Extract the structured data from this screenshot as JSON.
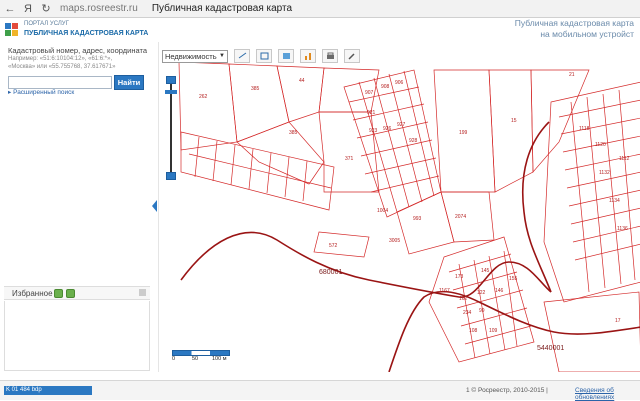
{
  "browser": {
    "back_icon": "back-arrow-icon",
    "yandex_label": "Я",
    "url": "maps.rosreestr.ru",
    "tab_title": "Публичная кадастровая карта"
  },
  "portal": {
    "logo_line1": "ПОРТАЛ УСЛУГ",
    "logo_line2": "ПУБЛИЧНАЯ КАДАСТРОВАЯ КАРТА",
    "mobile_line1": "Публичная кадастровая карта",
    "mobile_line2": "на мобильном устройст"
  },
  "search": {
    "label": "Кадастровый номер, адрес, координата",
    "example1": "Например: «51:6:10104:12», «61:6:*»,",
    "example2": "«Москва» или «55.755768, 37.617671»",
    "value": "",
    "find_button": "Найти",
    "advanced_link": "▸ Расширенный поиск"
  },
  "favorites": {
    "label": "Избранное"
  },
  "toolbar": {
    "layer_select": "Недвижимость"
  },
  "scale": {
    "ticks": [
      "0",
      "50",
      "100 м"
    ]
  },
  "status": {
    "coords": "K 01 484 bdp",
    "copyright": "1 © Росреестр, 2010-2015 |",
    "updates_link": "Сведения об обновлениях"
  },
  "map": {
    "block_labels": [
      "680001",
      "5440001",
      "3005",
      "1112"
    ],
    "parcel_labels": [
      "262",
      "385",
      "44",
      "385",
      "371",
      "199",
      "15",
      "21",
      "907",
      "908",
      "906",
      "921",
      "923",
      "926",
      "927",
      "928",
      "1004",
      "993",
      "2074",
      "572",
      "145",
      "146",
      "122",
      "99",
      "162",
      "1167",
      "108",
      "109",
      "155",
      "173",
      "234",
      "1118",
      "1120",
      "1132",
      "1134",
      "1136",
      "17"
    ],
    "colors": {
      "parcel": "#d42a2a",
      "boundary": "#9a1414",
      "background": "#ffffff"
    }
  }
}
